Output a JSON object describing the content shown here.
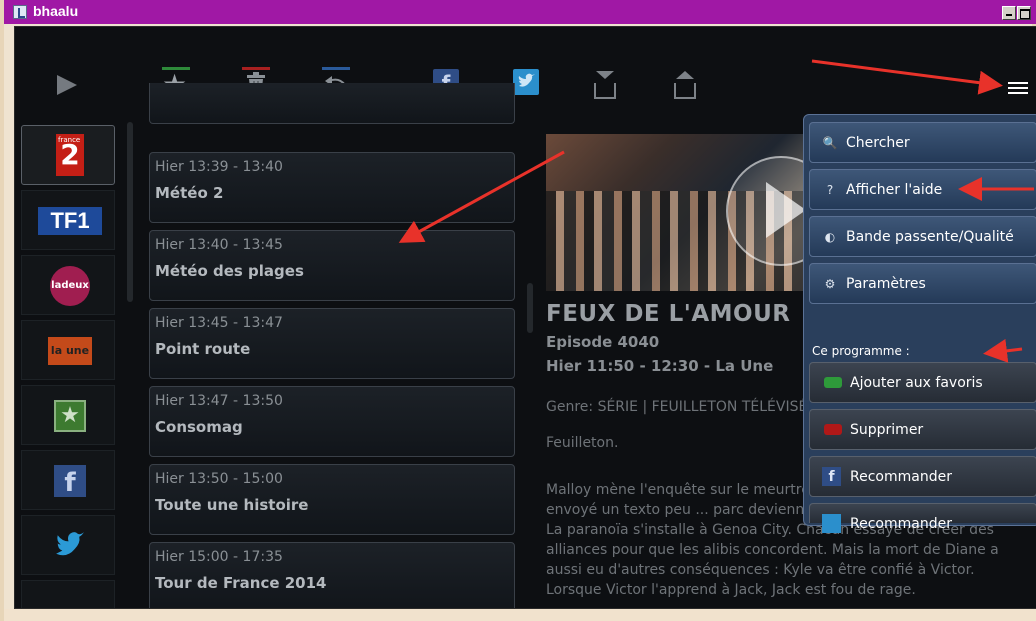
{
  "window": {
    "title": "bhaalu"
  },
  "toolbar": {
    "facebook_glyph": "f"
  },
  "channels": [
    {
      "id": "france2",
      "label": "2",
      "sublabel": "france"
    },
    {
      "id": "tf1",
      "label": "TF1"
    },
    {
      "id": "ladeux",
      "label": "ladeux"
    },
    {
      "id": "laune",
      "label": "la une"
    },
    {
      "id": "favorites"
    },
    {
      "id": "facebook",
      "label": "f"
    },
    {
      "id": "twitter"
    }
  ],
  "programmes": [
    {
      "time": "Hier 13:39 - 13:40",
      "name": "Météo 2"
    },
    {
      "time": "Hier 13:40 - 13:45",
      "name": "Météo des plages"
    },
    {
      "time": "Hier 13:45 - 13:47",
      "name": "Point route"
    },
    {
      "time": "Hier 13:47 - 13:50",
      "name": "Consomag"
    },
    {
      "time": "Hier 13:50 - 15:00",
      "name": "Toute une histoire"
    },
    {
      "time": "Hier 15:00 - 17:35",
      "name": "Tour de France 2014"
    }
  ],
  "detail": {
    "title": "FEUX DE L'AMOUR",
    "episode": "Episode 4040",
    "schedule": "Hier 11:50 - 12:30 - La Une",
    "genre": "Genre: SÉRIE | FEUILLETON TÉLÉVISÉ",
    "type": "Feuilleton.",
    "description": "Malloy mène l'enquête sur le meurtre ... auxquels Diane a envoyé un texto peu ... parc deviennent des suspects potentiels. La paranoïa s'installe à Genoa City. Chacun essaye de créer des alliances pour que les alibis concordent. Mais la mort de Diane a aussi eu d'autres conséquences : Kyle va être confié à Victor. Lorsque Victor l'apprend à Jack, Jack est fou de rage."
  },
  "menu": {
    "search": "Chercher",
    "help": "Afficher l'aide",
    "bandwidth": "Bande passente/Qualité",
    "settings": "Paramètres",
    "section_label": "Ce programme :",
    "add_favorite": "Ajouter aux favoris",
    "delete": "Supprimer",
    "recommend_facebook": "Recommander",
    "recommend_twitter": "Recommander",
    "fb_glyph": "f"
  },
  "colors": {
    "titlebar": "#a018a5",
    "menu_bg": "#2a3f5c",
    "annotation_arrow": "#e8322a",
    "favorite_green": "#2e9a3a",
    "delete_red": "#b01818"
  }
}
